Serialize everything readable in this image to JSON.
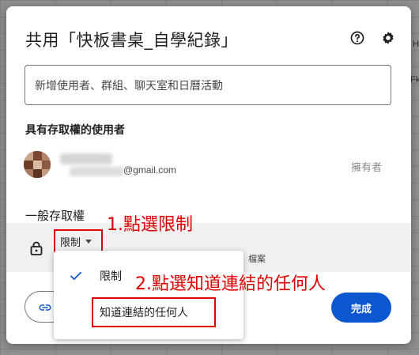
{
  "background": {
    "right_letters": [
      "H",
      "Fk"
    ]
  },
  "dialog": {
    "title": "共用「快板書桌_自學紀錄」",
    "help_icon": "help-circle-icon",
    "settings_icon": "gear-icon",
    "add_people_placeholder": "新增使用者、群組、聊天室和日曆活動",
    "people_section_label": "具有存取權的使用者",
    "person": {
      "email_suffix": "@gmail.com",
      "role": "擁有者"
    },
    "general_access_label": "一般存取權",
    "access_dropdown_value": "限制",
    "access_description_fragment": "檔案",
    "done_label": "完成",
    "accent_color": "#0b57d0"
  },
  "dropdown_menu": {
    "options": [
      {
        "label": "限制",
        "selected": true
      },
      {
        "label": "知道連結的任何人",
        "selected": false
      }
    ]
  },
  "annotations": {
    "step1": "1.點選限制",
    "step2": "2.點選知道連結的任何人",
    "color": "#e00000"
  }
}
